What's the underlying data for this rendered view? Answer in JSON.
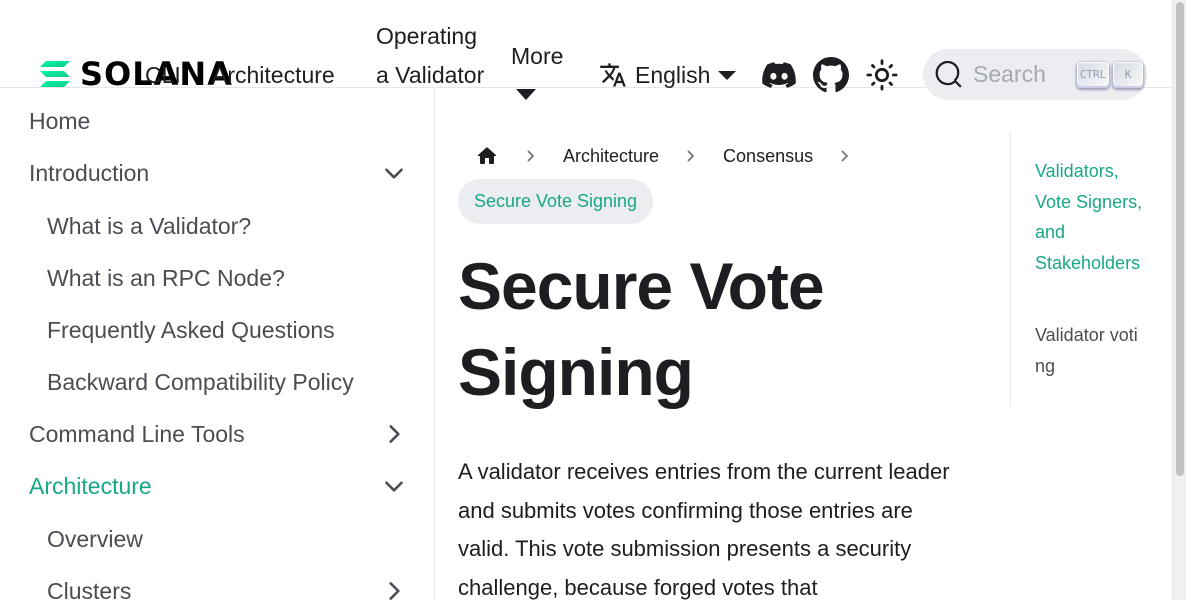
{
  "navbar": {
    "logo_text": "SOLANA",
    "links": {
      "cli": "CLI",
      "architecture": "Architecture",
      "operating": "Operating a Validator",
      "more": "More"
    },
    "language": "English",
    "search": {
      "placeholder": "Search",
      "shortcut_ctrl": "CTRL",
      "shortcut_key": "K"
    }
  },
  "sidebar": {
    "items": [
      {
        "label": "Home"
      },
      {
        "label": "Introduction"
      },
      {
        "label": "What is a Validator?"
      },
      {
        "label": "What is an RPC Node?"
      },
      {
        "label": "Frequently Asked Questions"
      },
      {
        "label": "Backward Compatibility Policy"
      },
      {
        "label": "Command Line Tools"
      },
      {
        "label": "Architecture"
      },
      {
        "label": "Overview"
      },
      {
        "label": "Clusters"
      }
    ]
  },
  "breadcrumbs": {
    "items": [
      "Architecture",
      "Consensus"
    ],
    "active": "Secure Vote Signing"
  },
  "main": {
    "title": "Secure Vote Signing",
    "paragraph": "A validator receives entries from the current leader and submits votes confirming those entries are valid. This vote submission presents a security challenge, because forged votes that"
  },
  "toc": {
    "items": [
      {
        "label": "Validators, Vote Signers, and Stakeholders"
      },
      {
        "label": "Validator voting"
      }
    ]
  },
  "colors": {
    "accent": "#19a78a",
    "text": "#1c1e21",
    "muted": "#4a4d52",
    "search_bg": "#ebedf0"
  }
}
